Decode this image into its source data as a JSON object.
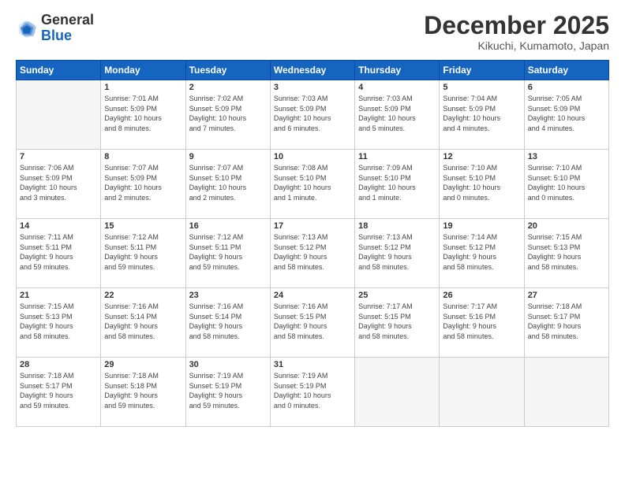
{
  "header": {
    "logo_general": "General",
    "logo_blue": "Blue",
    "month_title": "December 2025",
    "location": "Kikuchi, Kumamoto, Japan"
  },
  "days_of_week": [
    "Sunday",
    "Monday",
    "Tuesday",
    "Wednesday",
    "Thursday",
    "Friday",
    "Saturday"
  ],
  "weeks": [
    [
      {
        "day": "",
        "info": ""
      },
      {
        "day": "1",
        "info": "Sunrise: 7:01 AM\nSunset: 5:09 PM\nDaylight: 10 hours\nand 8 minutes."
      },
      {
        "day": "2",
        "info": "Sunrise: 7:02 AM\nSunset: 5:09 PM\nDaylight: 10 hours\nand 7 minutes."
      },
      {
        "day": "3",
        "info": "Sunrise: 7:03 AM\nSunset: 5:09 PM\nDaylight: 10 hours\nand 6 minutes."
      },
      {
        "day": "4",
        "info": "Sunrise: 7:03 AM\nSunset: 5:09 PM\nDaylight: 10 hours\nand 5 minutes."
      },
      {
        "day": "5",
        "info": "Sunrise: 7:04 AM\nSunset: 5:09 PM\nDaylight: 10 hours\nand 4 minutes."
      },
      {
        "day": "6",
        "info": "Sunrise: 7:05 AM\nSunset: 5:09 PM\nDaylight: 10 hours\nand 4 minutes."
      }
    ],
    [
      {
        "day": "7",
        "info": "Sunrise: 7:06 AM\nSunset: 5:09 PM\nDaylight: 10 hours\nand 3 minutes."
      },
      {
        "day": "8",
        "info": "Sunrise: 7:07 AM\nSunset: 5:09 PM\nDaylight: 10 hours\nand 2 minutes."
      },
      {
        "day": "9",
        "info": "Sunrise: 7:07 AM\nSunset: 5:10 PM\nDaylight: 10 hours\nand 2 minutes."
      },
      {
        "day": "10",
        "info": "Sunrise: 7:08 AM\nSunset: 5:10 PM\nDaylight: 10 hours\nand 1 minute."
      },
      {
        "day": "11",
        "info": "Sunrise: 7:09 AM\nSunset: 5:10 PM\nDaylight: 10 hours\nand 1 minute."
      },
      {
        "day": "12",
        "info": "Sunrise: 7:10 AM\nSunset: 5:10 PM\nDaylight: 10 hours\nand 0 minutes."
      },
      {
        "day": "13",
        "info": "Sunrise: 7:10 AM\nSunset: 5:10 PM\nDaylight: 10 hours\nand 0 minutes."
      }
    ],
    [
      {
        "day": "14",
        "info": "Sunrise: 7:11 AM\nSunset: 5:11 PM\nDaylight: 9 hours\nand 59 minutes."
      },
      {
        "day": "15",
        "info": "Sunrise: 7:12 AM\nSunset: 5:11 PM\nDaylight: 9 hours\nand 59 minutes."
      },
      {
        "day": "16",
        "info": "Sunrise: 7:12 AM\nSunset: 5:11 PM\nDaylight: 9 hours\nand 59 minutes."
      },
      {
        "day": "17",
        "info": "Sunrise: 7:13 AM\nSunset: 5:12 PM\nDaylight: 9 hours\nand 58 minutes."
      },
      {
        "day": "18",
        "info": "Sunrise: 7:13 AM\nSunset: 5:12 PM\nDaylight: 9 hours\nand 58 minutes."
      },
      {
        "day": "19",
        "info": "Sunrise: 7:14 AM\nSunset: 5:12 PM\nDaylight: 9 hours\nand 58 minutes."
      },
      {
        "day": "20",
        "info": "Sunrise: 7:15 AM\nSunset: 5:13 PM\nDaylight: 9 hours\nand 58 minutes."
      }
    ],
    [
      {
        "day": "21",
        "info": "Sunrise: 7:15 AM\nSunset: 5:13 PM\nDaylight: 9 hours\nand 58 minutes."
      },
      {
        "day": "22",
        "info": "Sunrise: 7:16 AM\nSunset: 5:14 PM\nDaylight: 9 hours\nand 58 minutes."
      },
      {
        "day": "23",
        "info": "Sunrise: 7:16 AM\nSunset: 5:14 PM\nDaylight: 9 hours\nand 58 minutes."
      },
      {
        "day": "24",
        "info": "Sunrise: 7:16 AM\nSunset: 5:15 PM\nDaylight: 9 hours\nand 58 minutes."
      },
      {
        "day": "25",
        "info": "Sunrise: 7:17 AM\nSunset: 5:15 PM\nDaylight: 9 hours\nand 58 minutes."
      },
      {
        "day": "26",
        "info": "Sunrise: 7:17 AM\nSunset: 5:16 PM\nDaylight: 9 hours\nand 58 minutes."
      },
      {
        "day": "27",
        "info": "Sunrise: 7:18 AM\nSunset: 5:17 PM\nDaylight: 9 hours\nand 58 minutes."
      }
    ],
    [
      {
        "day": "28",
        "info": "Sunrise: 7:18 AM\nSunset: 5:17 PM\nDaylight: 9 hours\nand 59 minutes."
      },
      {
        "day": "29",
        "info": "Sunrise: 7:18 AM\nSunset: 5:18 PM\nDaylight: 9 hours\nand 59 minutes."
      },
      {
        "day": "30",
        "info": "Sunrise: 7:19 AM\nSunset: 5:19 PM\nDaylight: 9 hours\nand 59 minutes."
      },
      {
        "day": "31",
        "info": "Sunrise: 7:19 AM\nSunset: 5:19 PM\nDaylight: 10 hours\nand 0 minutes."
      },
      {
        "day": "",
        "info": ""
      },
      {
        "day": "",
        "info": ""
      },
      {
        "day": "",
        "info": ""
      }
    ]
  ]
}
